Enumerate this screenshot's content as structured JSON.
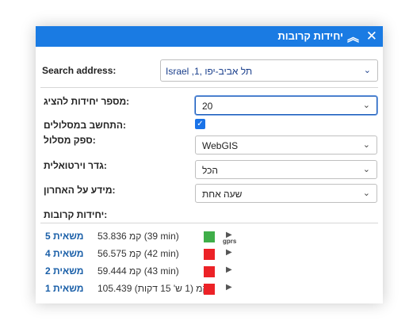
{
  "window": {
    "title": "יחידות קרובות",
    "close_icon": "✕",
    "collapse_icon": "︽"
  },
  "search": {
    "label": "Search address:",
    "value": "Israel ,1, תל אביב-יפו"
  },
  "fields": {
    "units_count": {
      "label": "מספר יחידות להציג:",
      "value": "20"
    },
    "calc_routes": {
      "label": "התחשב במסלולים:",
      "checked": true
    },
    "route_provider": {
      "label": "ספק מסלול:",
      "value": "WebGIS"
    },
    "virtual_fence": {
      "label": "גדר וירטואלית:",
      "value": "הכל"
    },
    "last_info": {
      "label": "מידע על האחרון:",
      "value": "שעה אחת"
    }
  },
  "units_label": "יחידות קרובות:",
  "units": [
    {
      "name": "משאית 5",
      "distance": "53.836 קמ (39 min)",
      "status_color": "#3fae49",
      "gprs": "gprs"
    },
    {
      "name": "משאית 4",
      "distance": "56.575 קמ (42 min)",
      "status_color": "#ec2227",
      "gprs": ""
    },
    {
      "name": "משאית 2",
      "distance": "59.444 קמ (43 min)",
      "status_color": "#ec2227",
      "gprs": ""
    },
    {
      "name": "משאית 1",
      "distance": "105.439 קמ (1 ש' 15 דקות)",
      "status_color": "#ec2227",
      "gprs": ""
    }
  ]
}
